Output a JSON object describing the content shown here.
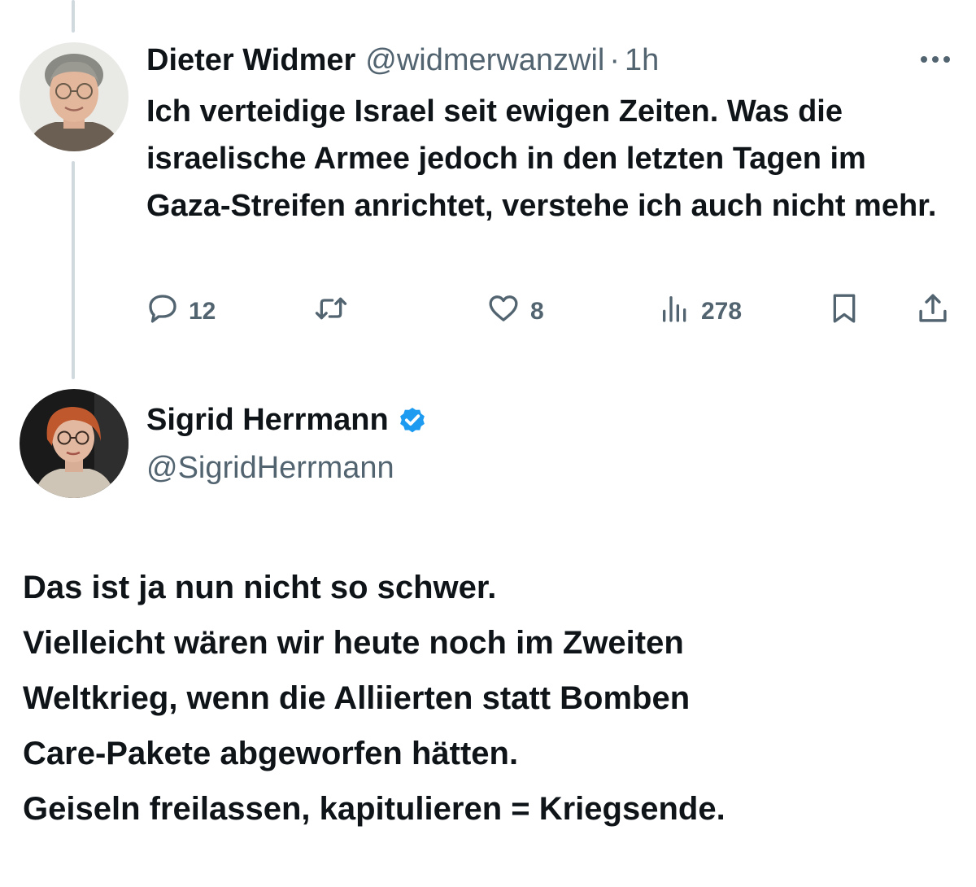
{
  "tweet1": {
    "author_name": "Dieter Widmer",
    "author_handle": "@widmerwanzwil",
    "separator": "·",
    "time": "1h",
    "more_icon": "more-horizontal-icon",
    "text": "Ich verteidige Israel seit ewigen Zeiten. Was die israelische Armee jedoch in den letzten Tagen im Gaza-Streifen anrichtet, verstehe ich auch nicht mehr.",
    "actions": {
      "reply_count": "12",
      "like_count": "8",
      "views_count": "278"
    }
  },
  "tweet2": {
    "author_name": "Sigrid Herrmann",
    "author_handle": "@SigridHerrmann",
    "verified": true,
    "lines": [
      "Das ist ja nun nicht so schwer.",
      "Vielleicht wären wir heute noch im Zweiten",
      "Weltkrieg, wenn die Alliierten statt Bomben",
      "Care-Pakete abgeworfen hätten.",
      "Geiseln freilassen, kapitulieren = Kriegsende."
    ]
  },
  "colors": {
    "text_primary": "#0f1419",
    "text_secondary": "#536471",
    "verified_blue": "#1d9bf0",
    "thread_line": "#cfd9de"
  }
}
